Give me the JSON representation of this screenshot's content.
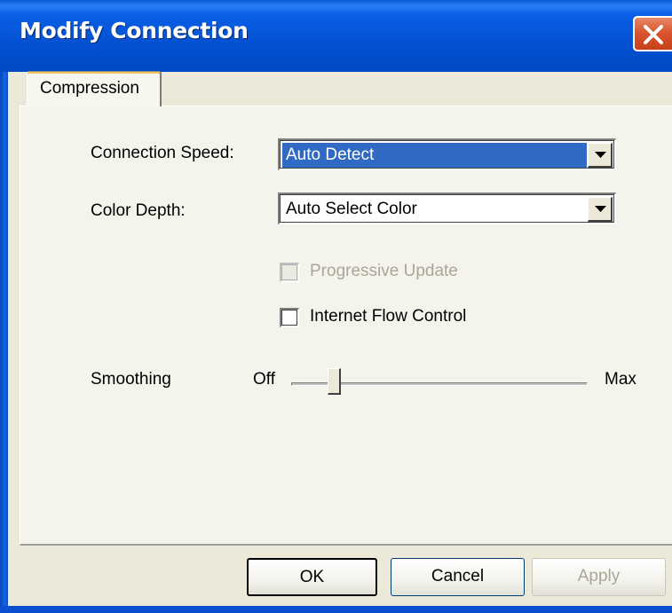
{
  "window": {
    "title": "Modify Connection",
    "close_icon": "close-icon"
  },
  "tabs": [
    {
      "label": "Compression",
      "active": true
    }
  ],
  "form": {
    "connection_speed": {
      "label": "Connection Speed:",
      "value": "Auto Detect"
    },
    "color_depth": {
      "label": "Color Depth:",
      "value": "Auto Select Color"
    },
    "progressive_update": {
      "label": "Progressive Update",
      "checked": false,
      "enabled": false
    },
    "internet_flow_control": {
      "label": "Internet Flow Control",
      "checked": false,
      "enabled": true
    },
    "smoothing": {
      "label": "Smoothing",
      "min_label": "Off",
      "max_label": "Max",
      "level": 0.13
    }
  },
  "buttons": {
    "ok": "OK",
    "cancel": "Cancel",
    "apply": "Apply"
  },
  "colors": {
    "titlebar": "#0553d4",
    "selection": "#316ac5",
    "close": "#d9562f"
  }
}
